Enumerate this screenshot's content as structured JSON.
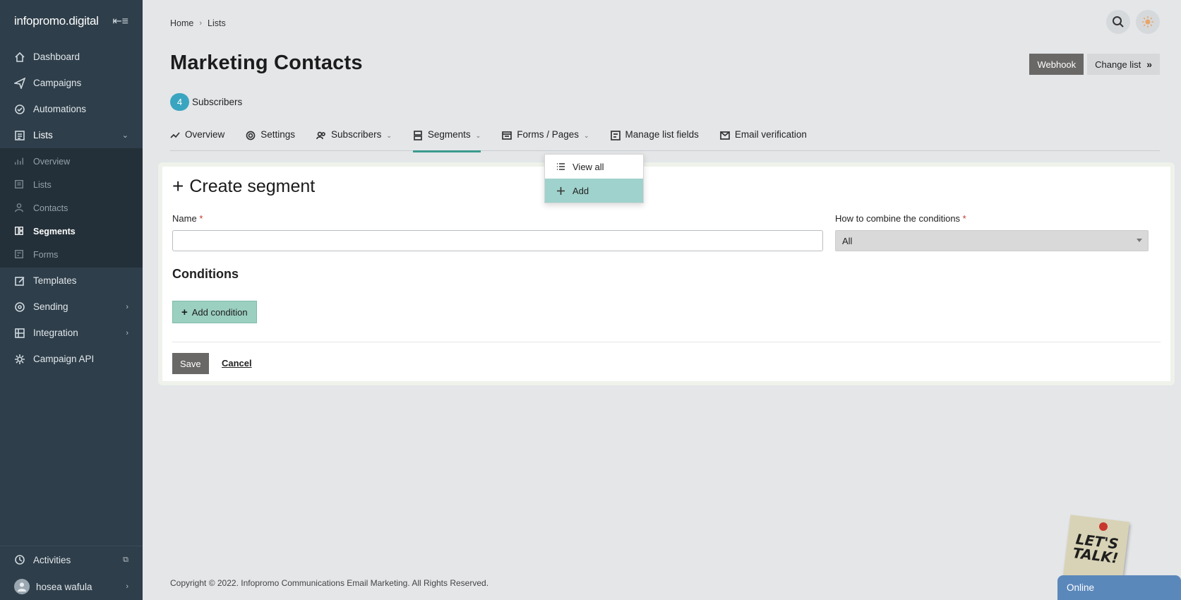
{
  "sidebar": {
    "logo": "infopromo.digital",
    "items": [
      {
        "label": "Dashboard",
        "icon": "home-icon"
      },
      {
        "label": "Campaigns",
        "icon": "send-icon"
      },
      {
        "label": "Automations",
        "icon": "automation-icon"
      },
      {
        "label": "Lists",
        "icon": "list-icon"
      }
    ],
    "sub_items": [
      {
        "label": "Overview"
      },
      {
        "label": "Lists"
      },
      {
        "label": "Contacts"
      },
      {
        "label": "Segments"
      },
      {
        "label": "Forms"
      }
    ],
    "items_after": [
      {
        "label": "Templates"
      },
      {
        "label": "Sending"
      },
      {
        "label": "Integration"
      },
      {
        "label": "Campaign API"
      }
    ],
    "bottom": {
      "activities": "Activities",
      "user": "hosea wafula"
    }
  },
  "breadcrumb": {
    "home": "Home",
    "current": "Lists"
  },
  "page": {
    "title": "Marketing Contacts",
    "subscriber_count": "4",
    "subscriber_label": "Subscribers",
    "webhook_label": "Webhook",
    "change_list_label": "Change list"
  },
  "tabs": [
    {
      "label": "Overview"
    },
    {
      "label": "Settings"
    },
    {
      "label": "Subscribers"
    },
    {
      "label": "Segments"
    },
    {
      "label": "Forms / Pages"
    },
    {
      "label": "Manage list fields"
    },
    {
      "label": "Email verification"
    }
  ],
  "dropdown": {
    "view_all": "View all",
    "add": "Add"
  },
  "form": {
    "title": "Create segment",
    "name_label": "Name",
    "combine_label": "How to combine the conditions",
    "combine_value": "All",
    "conditions_heading": "Conditions",
    "add_condition_label": "Add condition",
    "save_label": "Save",
    "cancel_label": "Cancel",
    "required_mark": "*"
  },
  "footer": "Copyright © 2022. Infopromo Communications Email Marketing. All Rights Reserved.",
  "chat": {
    "note_line1": "LET'S",
    "note_line2": "TALK!",
    "status": "Online"
  },
  "colors": {
    "sidebar": "#2e3e4a",
    "accent": "#3a9a8e",
    "badge": "#3aa5c0",
    "dark_button": "#6a6866"
  }
}
